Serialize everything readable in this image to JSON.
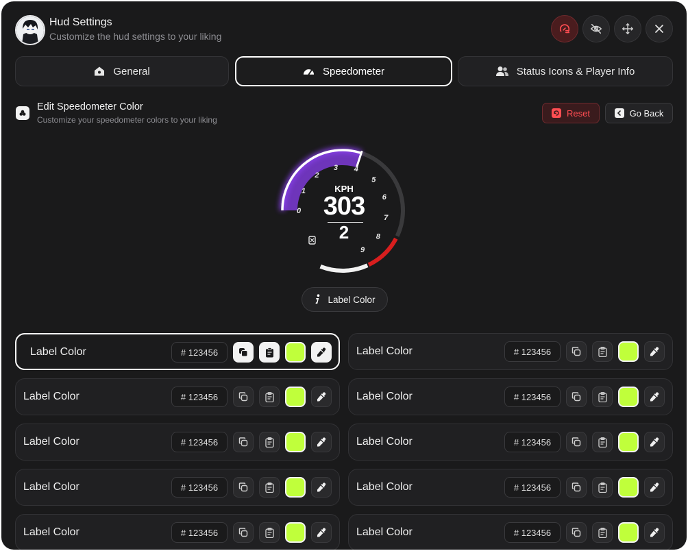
{
  "header": {
    "title": "Hud Settings",
    "subtitle": "Customize the hud settings to your liking",
    "buttons": {
      "reset_position": "reset-position-icon",
      "hide": "eye-off-icon",
      "move": "move-icon",
      "close": "close-icon"
    }
  },
  "tabs": [
    {
      "label": "General",
      "icon": "home-icon"
    },
    {
      "label": "Speedometer",
      "icon": "speedometer-icon",
      "active": true
    },
    {
      "label": "Status Icons & Player Info",
      "icon": "users-icon"
    }
  ],
  "section": {
    "title": "Edit Speedometer Color",
    "subtitle": "Customize your speedometer colors to your liking",
    "reset_label": "Reset",
    "back_label": "Go Back"
  },
  "gauge": {
    "unit": "KPH",
    "speed": "303",
    "gear": "2",
    "ticks": [
      "0",
      "1",
      "2",
      "3",
      "4",
      "5",
      "6",
      "7",
      "8",
      "9"
    ],
    "fuel_icon": "fuel-icon",
    "colors": {
      "progress": "#8b3ff0",
      "redline": "#d81e1e",
      "track": "#3a3a3c",
      "base": "#f2f2f2"
    }
  },
  "label_pill": {
    "text": "Label Color",
    "icon": "info-icon"
  },
  "color_rows": [
    {
      "label": "Label Color",
      "hex": "# 123456",
      "swatch": "#c0ff3b",
      "selected": true
    },
    {
      "label": "Label Color",
      "hex": "# 123456",
      "swatch": "#c0ff3b"
    },
    {
      "label": "Label Color",
      "hex": "# 123456",
      "swatch": "#c0ff3b"
    },
    {
      "label": "Label Color",
      "hex": "# 123456",
      "swatch": "#c0ff3b"
    },
    {
      "label": "Label Color",
      "hex": "# 123456",
      "swatch": "#c0ff3b"
    },
    {
      "label": "Label Color",
      "hex": "# 123456",
      "swatch": "#c0ff3b"
    },
    {
      "label": "Label Color",
      "hex": "# 123456",
      "swatch": "#c0ff3b"
    },
    {
      "label": "Label Color",
      "hex": "# 123456",
      "swatch": "#c0ff3b"
    },
    {
      "label": "Label Color",
      "hex": "# 123456",
      "swatch": "#c0ff3b"
    },
    {
      "label": "Label Color",
      "hex": "# 123456",
      "swatch": "#c0ff3b"
    }
  ],
  "row_icons": {
    "copy": "copy-icon",
    "paste": "clipboard-icon",
    "picker": "eyedropper-icon"
  }
}
